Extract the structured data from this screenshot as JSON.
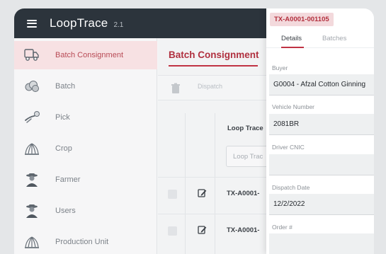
{
  "app": {
    "title": "LoopTrace",
    "version": "2.1"
  },
  "sidebar": {
    "items": [
      {
        "label": "Batch Consignment",
        "icon": "truck-icon",
        "active": true
      },
      {
        "label": "Batch",
        "icon": "cotton-boll-icon"
      },
      {
        "label": "Pick",
        "icon": "picking-hand-icon"
      },
      {
        "label": "Crop",
        "icon": "crop-plant-icon"
      },
      {
        "label": "Farmer",
        "icon": "farmer-icon"
      },
      {
        "label": "Users",
        "icon": "users-icon"
      },
      {
        "label": "Production Unit",
        "icon": "production-unit-icon"
      }
    ]
  },
  "main": {
    "title": "Batch Consignment",
    "toolbar": {
      "dispatch_label": "Dispatch"
    },
    "table": {
      "column_header": "Loop Trace",
      "filter_placeholder": "Loop Trac",
      "rows": [
        {
          "id": "TX-A0001-"
        },
        {
          "id": "TX-A0001-"
        }
      ]
    }
  },
  "panel": {
    "record_id": "TX-A0001-001105",
    "tabs": {
      "details": "Details",
      "batches": "Batches"
    },
    "fields": {
      "buyer": {
        "label": "Buyer",
        "value": "G0004 - Afzal Cotton Ginning"
      },
      "vehicle": {
        "label": "Vehicle Number",
        "value": "2081BR"
      },
      "driver_cnic": {
        "label": "Driver CNIC",
        "value": ""
      },
      "dispatch_date": {
        "label": "Dispatch Date",
        "value": "12/2/2022"
      },
      "order": {
        "label": "Order #",
        "value": ""
      }
    }
  },
  "colors": {
    "accent": "#c03344",
    "header": "#2c343c",
    "active_bg": "#f7e1e3"
  }
}
